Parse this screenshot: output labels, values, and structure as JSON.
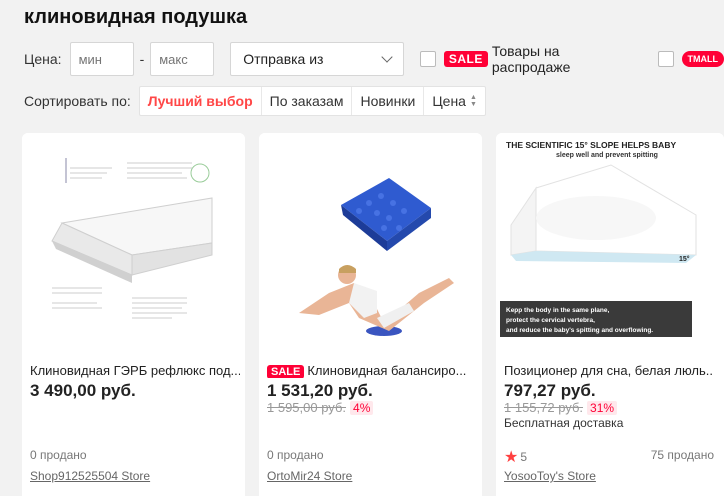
{
  "search": {
    "title": "клиновидная подушка"
  },
  "filters": {
    "price_label": "Цена:",
    "min_placeholder": "мин",
    "dash": "-",
    "max_placeholder": "макс",
    "ship_from": "Отправка из",
    "sale_badge": "SALE",
    "sale_text": "Товары на распродаже",
    "tmall_badge": "TMALL"
  },
  "sort": {
    "label": "Сортировать по:",
    "options": [
      "Лучший выбор",
      "По заказам",
      "Новинки",
      "Цена"
    ],
    "active": "Лучший выбор"
  },
  "products": [
    {
      "title": "Клиновидная ГЭРБ рефлюкс под...",
      "price": "3 490,00 руб.",
      "sold": "0 продано",
      "store": "Shop912525504 Store"
    },
    {
      "sale_badge": "SALE",
      "title": "Клиновидная балансиро...",
      "price": "1 531,20 руб.",
      "old_price": "1 595,00 руб.",
      "discount": "4%",
      "sold": "0 продано",
      "store": "OrtoMir24 Store"
    },
    {
      "title": "Позиционер для сна, белая люль...",
      "price": "797,27 руб.",
      "old_price": "1 155,72 руб.",
      "discount": "31%",
      "shipping": "Бесплатная доставка",
      "rating": "5",
      "sold": "75 продано",
      "store": "YosooToy's Store",
      "image_text": {
        "headline": "THE SCIENTIFIC 15° SLOPE HELPS BABY",
        "subline": "sleep well and prevent spitting",
        "angle": "15°",
        "caption_1": "Kepp the body in the same plane,",
        "caption_2": "protect the cervical vertebra,",
        "caption_3": "and reduce the baby's spitting and overflowing."
      }
    }
  ],
  "colors": {
    "accent": "#ff0036",
    "sort_active": "#ff4747",
    "background": "#f2f2f2"
  }
}
